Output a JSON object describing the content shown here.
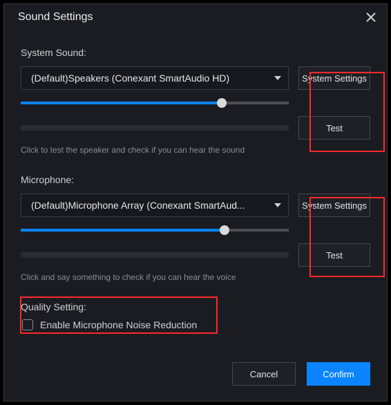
{
  "title": "Sound Settings",
  "system_sound": {
    "label": "System Sound:",
    "selected": "(Default)Speakers (Conexant SmartAudio HD)",
    "system_settings_btn": "System Settings",
    "test_btn": "Test",
    "volume_percent": 75,
    "hint": "Click to test the speaker and check if you can hear the sound"
  },
  "microphone": {
    "label": "Microphone:",
    "selected": "(Default)Microphone Array (Conexant SmartAud...",
    "system_settings_btn": "System Settings",
    "test_btn": "Test",
    "volume_percent": 76,
    "hint": "Click and say something to check if you can hear the voice"
  },
  "quality": {
    "label": "Quality Setting:",
    "checkbox_label": "Enable Microphone Noise Reduction",
    "checked": false
  },
  "footer": {
    "cancel": "Cancel",
    "confirm": "Confirm"
  },
  "colors": {
    "accent": "#0a84ff",
    "highlight": "#ff2a2a",
    "bg": "#1b1c22"
  }
}
